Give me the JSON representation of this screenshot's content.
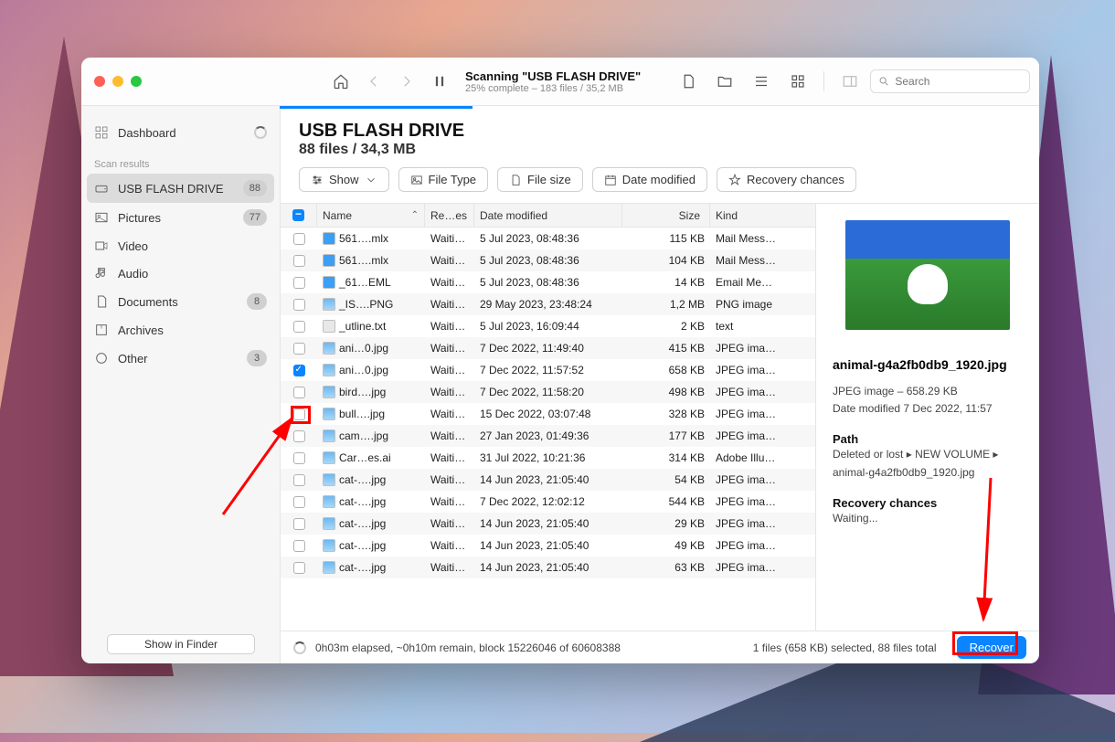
{
  "toolbar": {
    "scan_title": "Scanning \"USB FLASH DRIVE\"",
    "scan_subtitle": "25% complete – 183 files / 35,2 MB",
    "search_placeholder": "Search"
  },
  "sidebar": {
    "dashboard": "Dashboard",
    "section_header": "Scan results",
    "items": [
      {
        "label": "USB FLASH DRIVE",
        "badge": "88",
        "selected": true,
        "icon": "drive"
      },
      {
        "label": "Pictures",
        "badge": "77",
        "icon": "picture"
      },
      {
        "label": "Video",
        "badge": "",
        "icon": "video"
      },
      {
        "label": "Audio",
        "badge": "",
        "icon": "audio"
      },
      {
        "label": "Documents",
        "badge": "8",
        "icon": "doc"
      },
      {
        "label": "Archives",
        "badge": "",
        "icon": "archive"
      },
      {
        "label": "Other",
        "badge": "3",
        "icon": "other"
      }
    ]
  },
  "main": {
    "title": "USB FLASH DRIVE",
    "subtitle": "88 files / 34,3 MB",
    "filters": {
      "show": "Show",
      "filetype": "File Type",
      "filesize": "File size",
      "datemod": "Date modified",
      "recchances": "Recovery chances"
    },
    "columns": {
      "name": "Name",
      "rec": "Re…es",
      "date": "Date modified",
      "size": "Size",
      "kind": "Kind"
    },
    "rows": [
      {
        "name": "561….mlx",
        "rec": "Waiti…",
        "date": "5 Jul 2023, 08:48:36",
        "size": "115 KB",
        "kind": "Mail Mess…",
        "ico": "mail",
        "checked": false
      },
      {
        "name": "561….mlx",
        "rec": "Waiti…",
        "date": "5 Jul 2023, 08:48:36",
        "size": "104 KB",
        "kind": "Mail Mess…",
        "ico": "mail",
        "checked": false
      },
      {
        "name": "_61…EML",
        "rec": "Waiti…",
        "date": "5 Jul 2023, 08:48:36",
        "size": "14 KB",
        "kind": "Email Me…",
        "ico": "mail",
        "checked": false
      },
      {
        "name": "_IS….PNG",
        "rec": "Waiti…",
        "date": "29 May 2023, 23:48:24",
        "size": "1,2 MB",
        "kind": "PNG image",
        "ico": "img",
        "checked": false
      },
      {
        "name": "_utline.txt",
        "rec": "Waiti…",
        "date": "5 Jul 2023, 16:09:44",
        "size": "2 KB",
        "kind": "text",
        "ico": "txt",
        "checked": false
      },
      {
        "name": "ani…0.jpg",
        "rec": "Waiti…",
        "date": "7 Dec 2022, 11:49:40",
        "size": "415 KB",
        "kind": "JPEG ima…",
        "ico": "img",
        "checked": false
      },
      {
        "name": "ani…0.jpg",
        "rec": "Waiti…",
        "date": "7 Dec 2022, 11:57:52",
        "size": "658 KB",
        "kind": "JPEG ima…",
        "ico": "img",
        "checked": true
      },
      {
        "name": "bird….jpg",
        "rec": "Waiti…",
        "date": "7 Dec 2022, 11:58:20",
        "size": "498 KB",
        "kind": "JPEG ima…",
        "ico": "img",
        "checked": false
      },
      {
        "name": "bull….jpg",
        "rec": "Waiti…",
        "date": "15 Dec 2022, 03:07:48",
        "size": "328 KB",
        "kind": "JPEG ima…",
        "ico": "img",
        "checked": false
      },
      {
        "name": "cam….jpg",
        "rec": "Waiti…",
        "date": "27 Jan 2023, 01:49:36",
        "size": "177 KB",
        "kind": "JPEG ima…",
        "ico": "img",
        "checked": false
      },
      {
        "name": "Car…es.ai",
        "rec": "Waiti…",
        "date": "31 Jul 2022, 10:21:36",
        "size": "314 KB",
        "kind": "Adobe Illu…",
        "ico": "img",
        "checked": false
      },
      {
        "name": "cat-….jpg",
        "rec": "Waiti…",
        "date": "14 Jun 2023, 21:05:40",
        "size": "54 KB",
        "kind": "JPEG ima…",
        "ico": "img",
        "checked": false
      },
      {
        "name": "cat-….jpg",
        "rec": "Waiti…",
        "date": "7 Dec 2022, 12:02:12",
        "size": "544 KB",
        "kind": "JPEG ima…",
        "ico": "img",
        "checked": false
      },
      {
        "name": "cat-….jpg",
        "rec": "Waiti…",
        "date": "14 Jun 2023, 21:05:40",
        "size": "29 KB",
        "kind": "JPEG ima…",
        "ico": "img",
        "checked": false
      },
      {
        "name": "cat-….jpg",
        "rec": "Waiti…",
        "date": "14 Jun 2023, 21:05:40",
        "size": "49 KB",
        "kind": "JPEG ima…",
        "ico": "img",
        "checked": false
      },
      {
        "name": "cat-….jpg",
        "rec": "Waiti…",
        "date": "14 Jun 2023, 21:05:40",
        "size": "63 KB",
        "kind": "JPEG ima…",
        "ico": "img",
        "checked": false
      }
    ]
  },
  "preview": {
    "filename": "animal-g4a2fb0db9_1920.jpg",
    "kind_size": "JPEG image – 658.29 KB",
    "date_label": "Date modified",
    "date_value": "7 Dec 2022, 11:57",
    "path_label": "Path",
    "path_value": "Deleted or lost ▸ NEW VOLUME ▸ animal-g4a2fb0db9_1920.jpg",
    "rec_label": "Recovery chances",
    "rec_value": "Waiting..."
  },
  "footer": {
    "elapsed": "0h03m elapsed, ~0h10m remain, block 15226046 of 60608388",
    "selection": "1 files (658 KB) selected, 88 files total",
    "recover": "Recover",
    "show_finder": "Show in Finder"
  }
}
